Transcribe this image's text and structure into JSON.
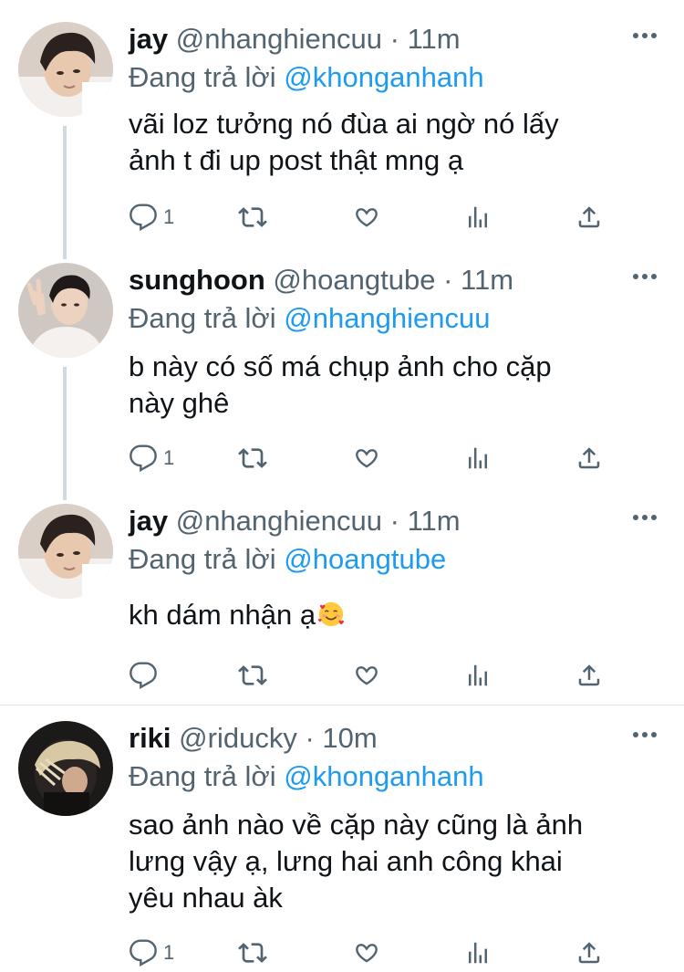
{
  "colors": {
    "text": "#0f1419",
    "secondary": "#536471",
    "link": "#1d9bf0",
    "thread_line": "#cfd9de"
  },
  "tweets": [
    {
      "name": "jay",
      "handle": "@nhanghiencuu",
      "dot": "·",
      "time": "11m",
      "replying_prefix": "Đang trả lời",
      "replying_to": "@khonganhanh",
      "text_lines": [
        "vãi loz tưởng nó đùa ai ngờ nó lấy",
        "ảnh t đi up post thật mng ạ"
      ],
      "reply_count": "1",
      "icons": [
        "reply-icon",
        "retweet-icon",
        "like-icon",
        "analytics-icon",
        "share-icon",
        "more-icon"
      ]
    },
    {
      "name": "sunghoon",
      "handle": "@hoangtube",
      "dot": "·",
      "time": "11m",
      "replying_prefix": "Đang trả lời",
      "replying_to": "@nhanghiencuu",
      "text_lines": [
        "b này có số má chụp ảnh cho cặp",
        "này ghê"
      ],
      "reply_count": "1",
      "icons": [
        "reply-icon",
        "retweet-icon",
        "like-icon",
        "analytics-icon",
        "share-icon",
        "more-icon"
      ]
    },
    {
      "name": "jay",
      "handle": "@nhanghiencuu",
      "dot": "·",
      "time": "11m",
      "replying_prefix": "Đang trả lời",
      "replying_to": "@hoangtube",
      "text_lines": [
        "kh dám nhận ạ"
      ],
      "emoji": "smiling-face-with-hearts",
      "reply_count": "",
      "icons": [
        "reply-icon",
        "retweet-icon",
        "like-icon",
        "analytics-icon",
        "share-icon",
        "more-icon"
      ]
    },
    {
      "name": "riki",
      "handle": "@riducky",
      "dot": "·",
      "time": "10m",
      "replying_prefix": "Đang trả lời",
      "replying_to": "@khonganhanh",
      "text_lines": [
        "sao ảnh nào về cặp này cũng là ảnh",
        "lưng vậy ạ, lưng hai anh công khai",
        "yêu nhau àk"
      ],
      "reply_count": "1",
      "icons": [
        "reply-icon",
        "retweet-icon",
        "like-icon",
        "analytics-icon",
        "share-icon",
        "more-icon"
      ]
    }
  ]
}
